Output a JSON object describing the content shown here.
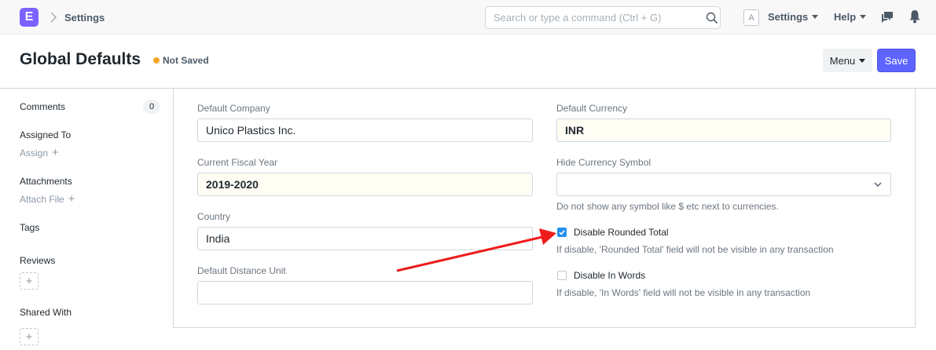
{
  "navbar": {
    "logo_letter": "E",
    "breadcrumb": "Settings",
    "search_placeholder": "Search or type a command (Ctrl + G)",
    "avatar_letter": "A",
    "settings_label": "Settings",
    "help_label": "Help",
    "icons": [
      "search-icon",
      "chat-icon",
      "bell-icon",
      "chevron-right-icon"
    ]
  },
  "header": {
    "title": "Global Defaults",
    "status": "Not Saved",
    "status_color": "#f5a623",
    "menu_label": "Menu",
    "save_label": "Save",
    "accent_color": "#5e64ff"
  },
  "sidebar": {
    "comments_label": "Comments",
    "comments_count": "0",
    "assigned_to_label": "Assigned To",
    "assign_label": "Assign",
    "attachments_label": "Attachments",
    "attach_file_label": "Attach File",
    "tags_label": "Tags",
    "reviews_label": "Reviews",
    "shared_with_label": "Shared With",
    "add_symbol": "+"
  },
  "form": {
    "default_company": {
      "label": "Default Company",
      "value": "Unico Plastics Inc."
    },
    "current_fiscal_year": {
      "label": "Current Fiscal Year",
      "value": "2019-2020"
    },
    "country": {
      "label": "Country",
      "value": "India"
    },
    "default_distance_unit": {
      "label": "Default Distance Unit",
      "value": ""
    },
    "default_currency": {
      "label": "Default Currency",
      "value": "INR"
    },
    "hide_currency_symbol": {
      "label": "Hide Currency Symbol",
      "value": "",
      "description": "Do not show any symbol like $ etc next to currencies."
    },
    "disable_rounded_total": {
      "label": "Disable Rounded Total",
      "checked": true,
      "description": "If disable, 'Rounded Total' field will not be visible in any transaction"
    },
    "disable_in_words": {
      "label": "Disable In Words",
      "checked": false,
      "description": "If disable, 'In Words' field will not be visible in any transaction"
    }
  },
  "annotation": {
    "arrow_color": "#ee1c1c"
  }
}
